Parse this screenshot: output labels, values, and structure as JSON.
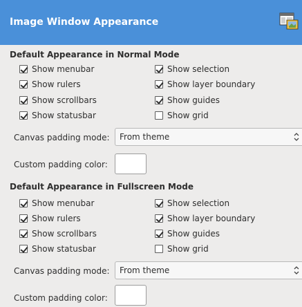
{
  "header": {
    "title": "Image Window Appearance",
    "icon": "window-appearance-icon"
  },
  "normal": {
    "section_title": "Default Appearance in Normal Mode",
    "checkboxes": [
      {
        "label": "Show menubar",
        "checked": true
      },
      {
        "label": "Show rulers",
        "checked": true
      },
      {
        "label": "Show scrollbars",
        "checked": true
      },
      {
        "label": "Show statusbar",
        "checked": true
      },
      {
        "label": "Show selection",
        "checked": true
      },
      {
        "label": "Show layer boundary",
        "checked": true
      },
      {
        "label": "Show guides",
        "checked": true
      },
      {
        "label": "Show grid",
        "checked": false
      }
    ],
    "padding_mode_label": "Canvas padding mode:",
    "padding_mode_value": "From theme",
    "padding_color_label": "Custom padding color:",
    "padding_color": "#ffffff"
  },
  "fullscreen": {
    "section_title": "Default Appearance in Fullscreen Mode",
    "checkboxes": [
      {
        "label": "Show menubar",
        "checked": true
      },
      {
        "label": "Show rulers",
        "checked": true
      },
      {
        "label": "Show scrollbars",
        "checked": true
      },
      {
        "label": "Show statusbar",
        "checked": true
      },
      {
        "label": "Show selection",
        "checked": true
      },
      {
        "label": "Show layer boundary",
        "checked": true
      },
      {
        "label": "Show guides",
        "checked": true
      },
      {
        "label": "Show grid",
        "checked": false
      }
    ],
    "padding_mode_label": "Canvas padding mode:",
    "padding_mode_value": "From theme",
    "padding_color_label": "Custom padding color:",
    "padding_color": "#ffffff"
  },
  "colors": {
    "header_bg": "#4a90d9",
    "window_bg": "#edeceb"
  }
}
